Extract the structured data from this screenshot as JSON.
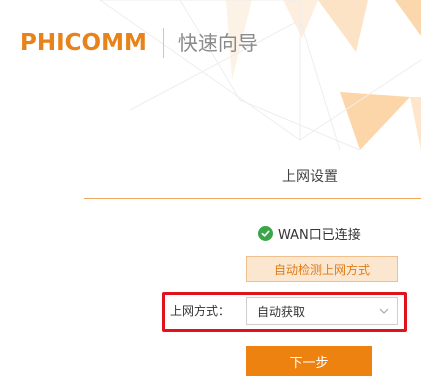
{
  "header": {
    "logo": "PHICOMM",
    "subtitle": "快速向导"
  },
  "section": {
    "title": "上网设置"
  },
  "status": {
    "icon": "check-circle-icon",
    "text": "WAN口已连接",
    "color": "#3aa64a"
  },
  "detect_button": {
    "label": "自动检测上网方式"
  },
  "connection_method": {
    "label": "上网方式：",
    "selected": "自动获取"
  },
  "next_button": {
    "label": "下一步"
  },
  "colors": {
    "brand_orange": "#e8821a",
    "button_orange": "#ee8210",
    "highlight_red": "#e0121c",
    "success_green": "#3aa64a"
  }
}
